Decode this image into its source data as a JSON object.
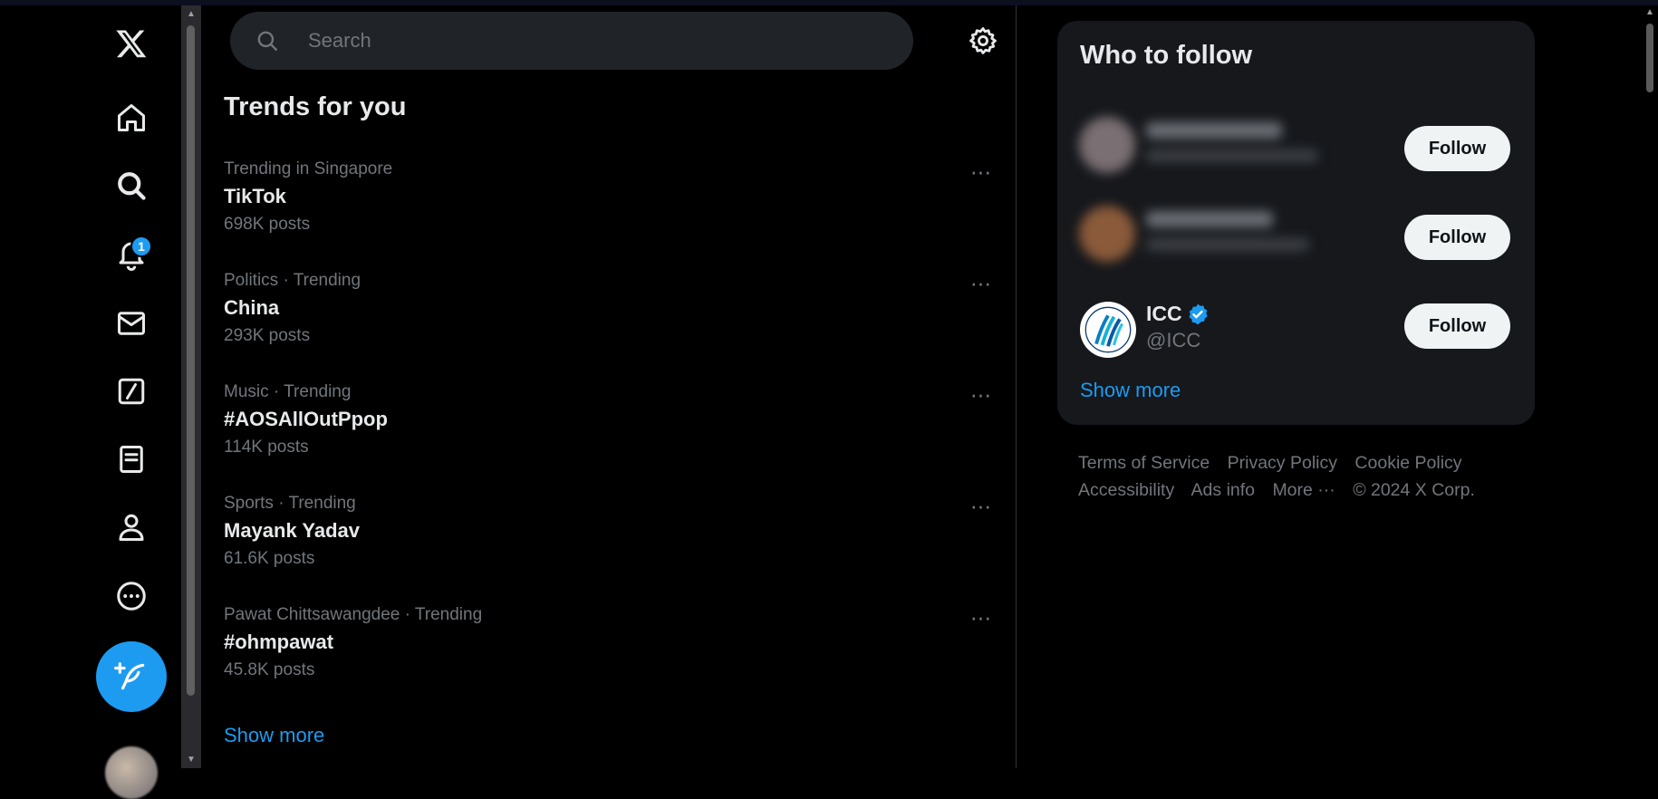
{
  "nav": {
    "notifications_badge": "1"
  },
  "search": {
    "placeholder": "Search"
  },
  "trends": {
    "title": "Trends for you",
    "items": [
      {
        "meta": "Trending in Singapore",
        "name": "TikTok",
        "count": "698K posts"
      },
      {
        "meta": "Politics · Trending",
        "name": "China",
        "count": "293K posts"
      },
      {
        "meta": "Music · Trending",
        "name": "#AOSAllOutPpop",
        "count": "114K posts"
      },
      {
        "meta": "Sports · Trending",
        "name": "Mayank Yadav",
        "count": "61.6K posts"
      },
      {
        "meta": "Pawat Chittsawangdee · Trending",
        "name": "#ohmpawat",
        "count": "45.8K posts"
      }
    ],
    "more_glyph": "···",
    "show_more": "Show more"
  },
  "who_to_follow": {
    "title": "Who to follow",
    "accounts": [
      {
        "name": "",
        "handle": "",
        "follow_label": "Follow"
      },
      {
        "name": "",
        "handle": "",
        "follow_label": "Follow"
      },
      {
        "name": "ICC",
        "handle": "@ICC",
        "follow_label": "Follow"
      }
    ],
    "show_more": "Show more"
  },
  "footer": {
    "links": [
      "Terms of Service",
      "Privacy Policy",
      "Cookie Policy",
      "Accessibility",
      "Ads info",
      "More ···",
      "© 2024 X Corp."
    ]
  },
  "colors": {
    "accent": "#1d9bf0",
    "background": "#000000",
    "card": "#16181c",
    "muted_text": "#71767b"
  }
}
